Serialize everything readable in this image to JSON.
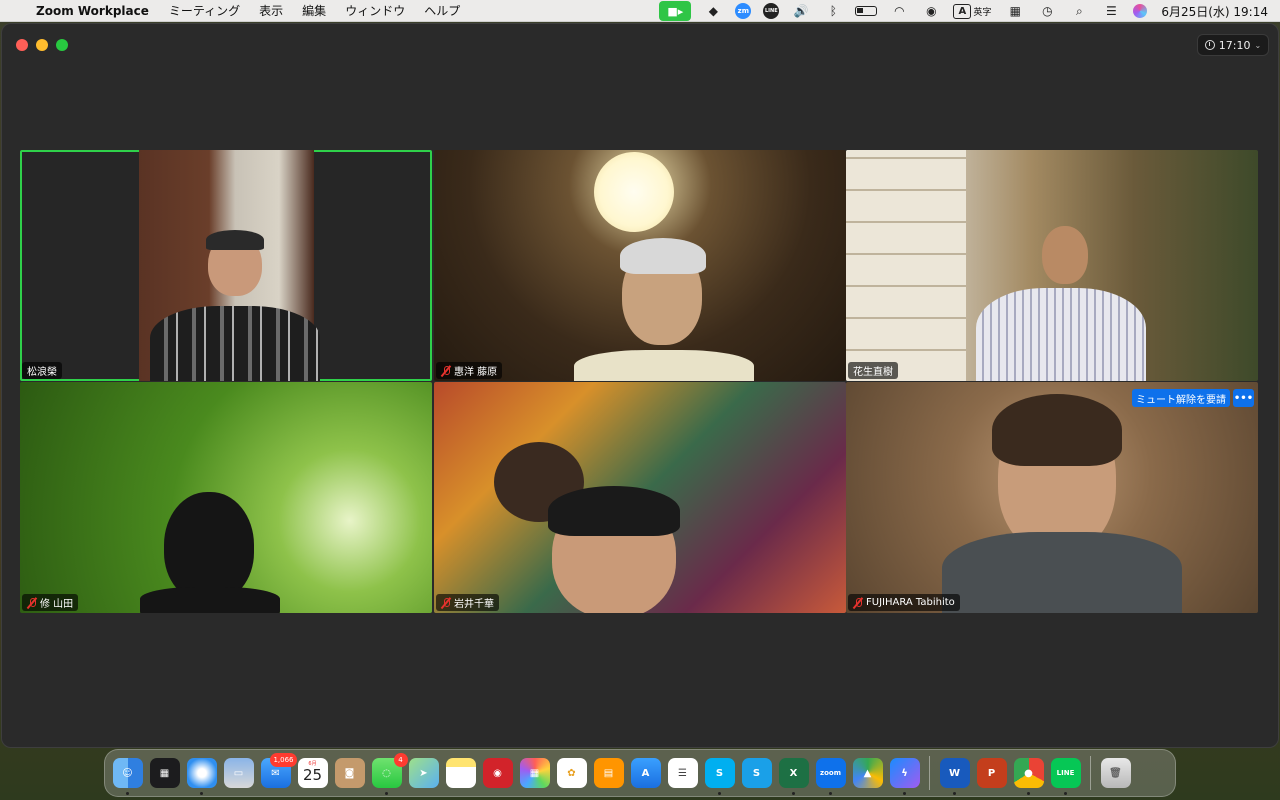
{
  "menubar": {
    "app_name": "Zoom Workplace",
    "menus": [
      "ミーティング",
      "表示",
      "編集",
      "ウィンドウ",
      "ヘルプ"
    ],
    "input_mode_glyph": "A",
    "input_mode_label": "英字",
    "date_time": "6月25日(水)  19:14"
  },
  "window": {
    "timer": "17:10"
  },
  "participants": [
    {
      "name": "松浪榮",
      "muted": false,
      "speaking": true
    },
    {
      "name": "惠洋 藤原",
      "muted": true,
      "speaking": false
    },
    {
      "name": "花生直樹",
      "muted": false,
      "speaking": false
    },
    {
      "name": "修 山田",
      "muted": true,
      "speaking": false
    },
    {
      "name": "岩井千華",
      "muted": true,
      "speaking": false
    },
    {
      "name": "FUJIHARA Tabihito",
      "muted": true,
      "speaking": false
    }
  ],
  "tile_actions": {
    "ask_unmute_label": "ミュート解除を要請",
    "more_label": "•••"
  },
  "dock": {
    "mail_badge": "1,066",
    "messages_badge": "4",
    "calendar_month": "6月",
    "calendar_day": "25",
    "zoom_label": "zoom",
    "colors": {
      "accent_blue": "#0e71eb",
      "speaking_green": "#2fd14a",
      "muted_red": "#e5322d"
    }
  }
}
